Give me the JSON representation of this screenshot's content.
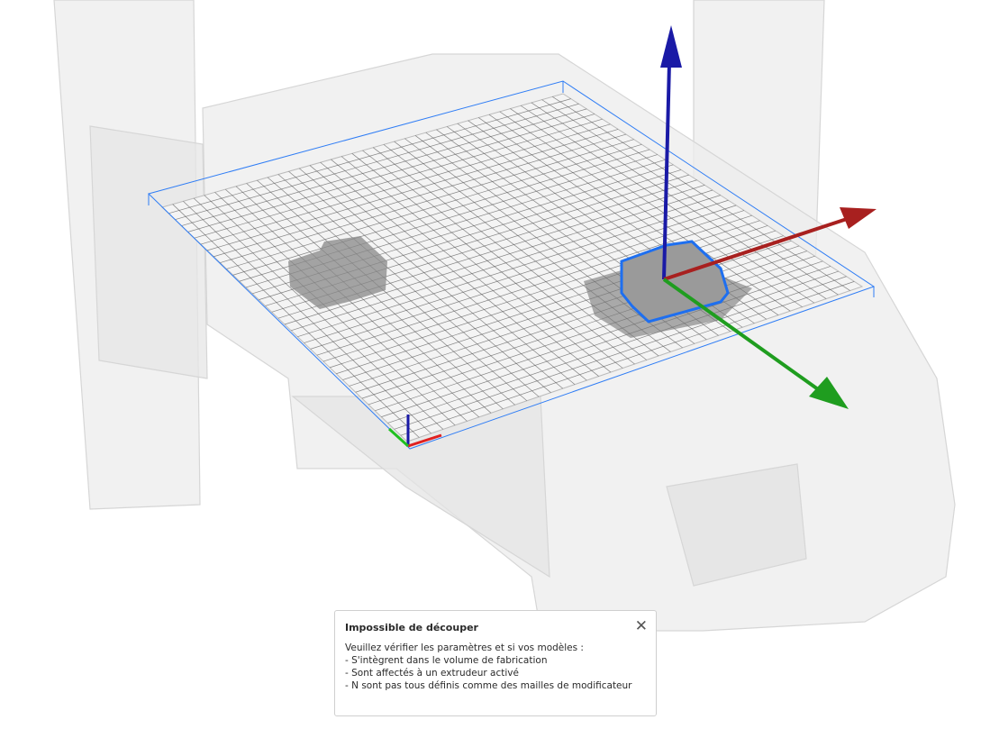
{
  "message": {
    "title": "Impossible de découper",
    "lines": [
      "Veuillez vérifier les paramètres et si vos modèles :",
      "- S'intègrent dans le volume de fabrication",
      "- Sont affectés à un extrudeur activé",
      "- N sont pas tous définis comme des mailles de modificateur"
    ],
    "close_icon": "close-icon"
  },
  "colors": {
    "axis_x": "#a8201f",
    "axis_y": "#1f9d1f",
    "axis_z": "#1a1aa6",
    "selection": "#1e6ff0",
    "build_volume": "#2f7df5"
  }
}
